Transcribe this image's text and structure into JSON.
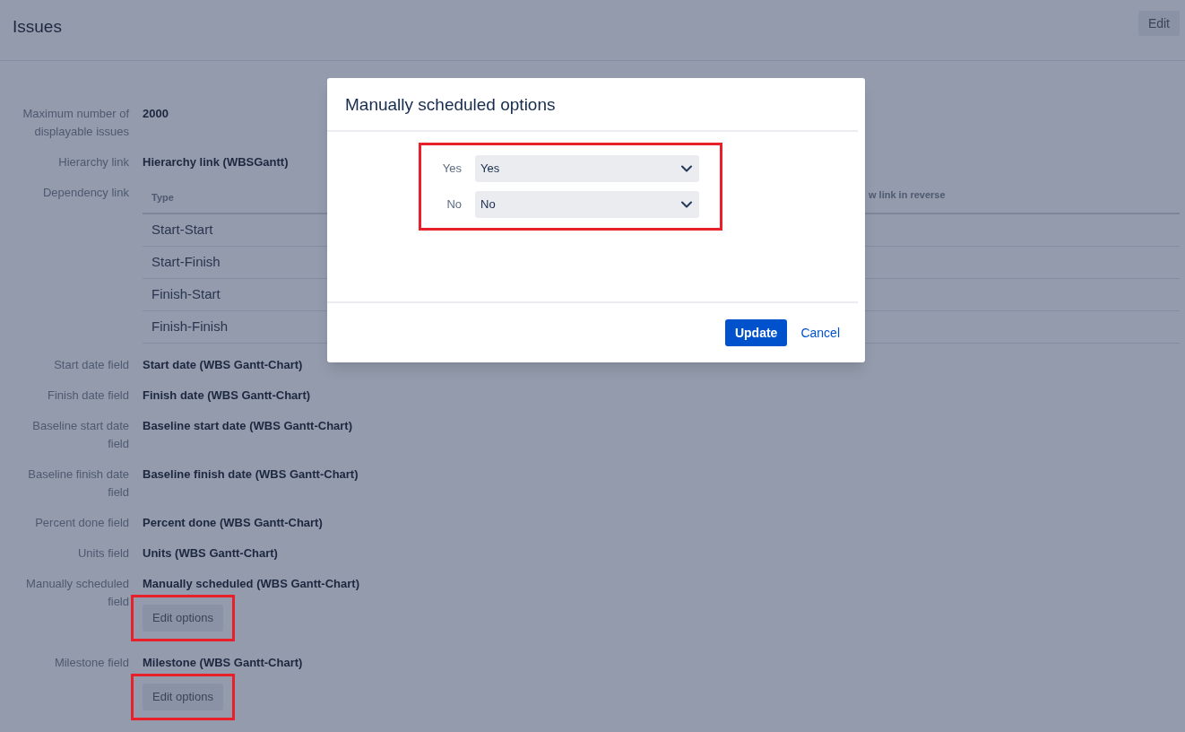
{
  "page": {
    "title": "Issues",
    "edit_button": "Edit"
  },
  "fields": [
    {
      "kind": "text",
      "label": "Maximum number of displayable issues",
      "value": "2000"
    },
    {
      "kind": "text",
      "label": "Hierarchy link",
      "value": "Hierarchy link (WBSGantt)"
    },
    {
      "kind": "table",
      "label": "Dependency link",
      "columns": [
        "Type",
        "w link in reverse"
      ],
      "rows": [
        "Start-Start",
        "Start-Finish",
        "Finish-Start",
        "Finish-Finish"
      ]
    },
    {
      "kind": "text",
      "label": "Start date field",
      "value": "Start date (WBS Gantt-Chart)"
    },
    {
      "kind": "text",
      "label": "Finish date field",
      "value": "Finish date (WBS Gantt-Chart)"
    },
    {
      "kind": "text",
      "label": "Baseline start date field",
      "value": "Baseline start date (WBS Gantt-Chart)"
    },
    {
      "kind": "text",
      "label": "Baseline finish date field",
      "value": "Baseline finish date (WBS Gantt-Chart)"
    },
    {
      "kind": "text",
      "label": "Percent done field",
      "value": "Percent done (WBS Gantt-Chart)"
    },
    {
      "kind": "text",
      "label": "Units field",
      "value": "Units (WBS Gantt-Chart)"
    },
    {
      "kind": "options",
      "label": "Manually scheduled field",
      "value": "Manually scheduled (WBS Gantt-Chart)",
      "button": "Edit options",
      "highlighted": true
    },
    {
      "kind": "options",
      "label": "Milestone field",
      "value": "Milestone (WBS Gantt-Chart)",
      "button": "Edit options",
      "highlighted": true
    }
  ],
  "dialog": {
    "title": "Manually scheduled options",
    "highlighted": true,
    "options": [
      {
        "label": "Yes",
        "value": "Yes"
      },
      {
        "label": "No",
        "value": "No"
      }
    ],
    "primary_button": "Update",
    "cancel_link": "Cancel"
  }
}
